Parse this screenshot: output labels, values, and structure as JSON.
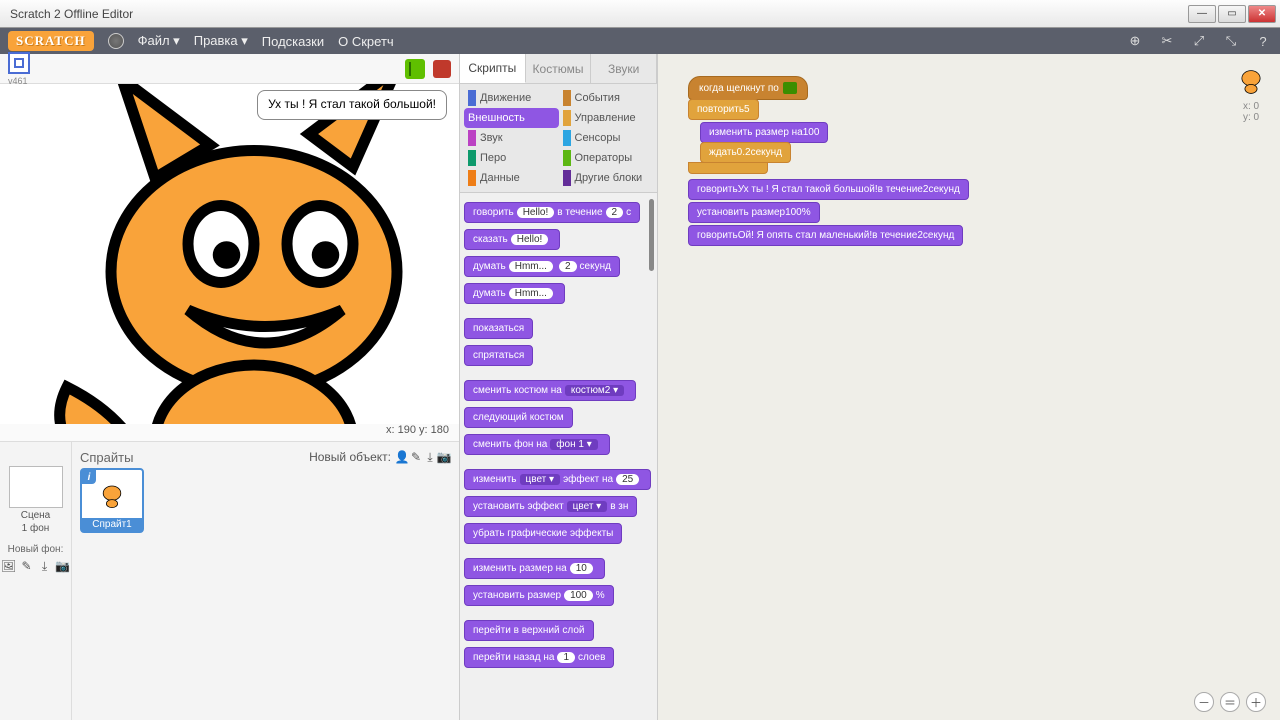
{
  "window": {
    "title": "Scratch 2 Offline Editor"
  },
  "menubar": {
    "logo": "SCRATCH",
    "file": "Файл ▾",
    "edit": "Правка ▾",
    "tips": "Подсказки",
    "about": "О Скретч"
  },
  "stage": {
    "version": "v461",
    "speech": "Ух ты ! Я стал такой большой!",
    "coords": "x: 190   y: 180"
  },
  "sprites": {
    "title": "Спрайты",
    "new_object": "Новый объект:",
    "scene_label": "Сцена",
    "scene_sub": "1 фон",
    "new_backdrop": "Новый фон:",
    "sprite1": "Спрайт1"
  },
  "tabs": {
    "scripts": "Скрипты",
    "costumes": "Костюмы",
    "sounds": "Звуки"
  },
  "categories": {
    "motion": "Движение",
    "events": "События",
    "looks": "Внешность",
    "control": "Управление",
    "sound": "Звук",
    "sensing": "Сенсоры",
    "pen": "Перо",
    "operators": "Операторы",
    "data": "Данные",
    "more": "Другие блоки"
  },
  "palette": {
    "b1a": "говорить",
    "b1b": "Hello!",
    "b1c": "в течение",
    "b1d": "2",
    "b1e": "с",
    "b2a": "сказать",
    "b2b": "Hello!",
    "b3a": "думать",
    "b3b": "Hmm...",
    "b3c": "2",
    "b3d": "секунд",
    "b4a": "думать",
    "b4b": "Hmm...",
    "b5": "показаться",
    "b6": "спрятаться",
    "b7a": "сменить костюм на",
    "b7b": "костюм2 ▾",
    "b8": "следующий костюм",
    "b9a": "сменить фон на",
    "b9b": "фон 1 ▾",
    "b10a": "изменить",
    "b10b": "цвет ▾",
    "b10c": "эффект на",
    "b10d": "25",
    "b11a": "установить эффект",
    "b11b": "цвет ▾",
    "b11c": "в зн",
    "b12": "убрать графические эффекты",
    "b13a": "изменить размер на",
    "b13b": "10",
    "b14a": "установить размер",
    "b14b": "100",
    "b14c": "%",
    "b15": "перейти в верхний слой",
    "b16a": "перейти назад на",
    "b16b": "1",
    "b16c": "слоев"
  },
  "script": {
    "hat": "когда щелкнут по",
    "repeat": "повторить",
    "repeat_n": "5",
    "change_size": "изменить размер на",
    "change_size_v": "100",
    "wait": "ждать",
    "wait_v": "0.2",
    "wait_u": "секунд",
    "say1a": "говорить",
    "say1b": "Ух ты ! Я стал такой большой!",
    "say1c": "в течение",
    "say1d": "2",
    "say1e": "секунд",
    "setsize": "установить размер",
    "setsize_v": "100",
    "setsize_u": "%",
    "say2a": "говорить",
    "say2b": "Ой! Я опять стал маленький!",
    "say2c": "в течение",
    "say2d": "2",
    "say2e": "секунд"
  },
  "corner": {
    "x": "x: 0",
    "y": "y: 0"
  }
}
